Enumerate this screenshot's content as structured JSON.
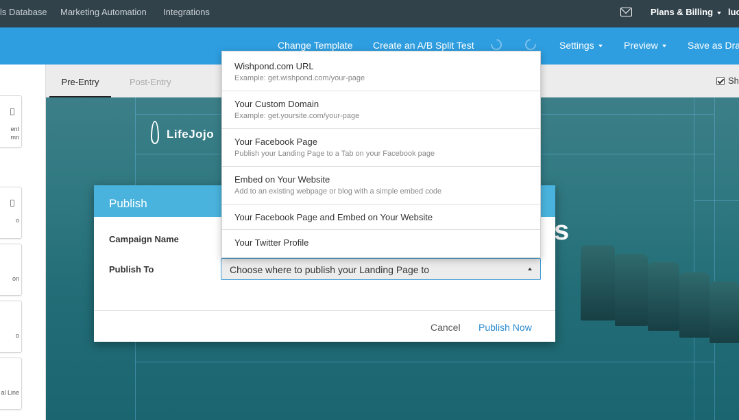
{
  "topnav": {
    "links": [
      "ls Database",
      "Marketing Automation",
      "Integrations"
    ],
    "plans_label": "Plans & Billing",
    "user_label": "luc"
  },
  "toolbar": {
    "change_template": "Change Template",
    "ab_test": "Create an A/B Split Test",
    "settings": "Settings",
    "preview": "Preview",
    "save_draft": "Save as Draft"
  },
  "tabs": {
    "pre_entry": "Pre-Entry",
    "post_entry": "Post-Entry",
    "show_label": "Sh"
  },
  "sidebar": {
    "cards": [
      {
        "line1": "ent",
        "line2": "mn"
      },
      {
        "line1": "o",
        "line2": ""
      },
      {
        "line1": "on",
        "line2": ""
      },
      {
        "line1": "o",
        "line2": ""
      },
      {
        "line1": "al Line",
        "line2": ""
      }
    ]
  },
  "canvas": {
    "logo": "LifeJojo",
    "headline_fragment": "s"
  },
  "modal": {
    "title": "Publish",
    "campaign_name_label": "Campaign Name",
    "publish_to_label": "Publish To",
    "select_value": "Choose where to publish your Landing Page to",
    "cancel": "Cancel",
    "publish_now": "Publish Now"
  },
  "dropdown": {
    "items": [
      {
        "title": "Wishpond.com URL",
        "subtitle": "Example: get.wishpond.com/your-page"
      },
      {
        "title": "Your Custom Domain",
        "subtitle": "Example: get.yoursite.com/your-page"
      },
      {
        "title": "Your Facebook Page",
        "subtitle": "Publish your Landing Page to a Tab on your Facebook page"
      },
      {
        "title": "Embed on Your Website",
        "subtitle": "Add to an existing webpage or blog with a simple embed code"
      },
      {
        "title": "Your Facebook Page and Embed on Your Website",
        "subtitle": ""
      },
      {
        "title": "Your Twitter Profile",
        "subtitle": ""
      }
    ]
  }
}
